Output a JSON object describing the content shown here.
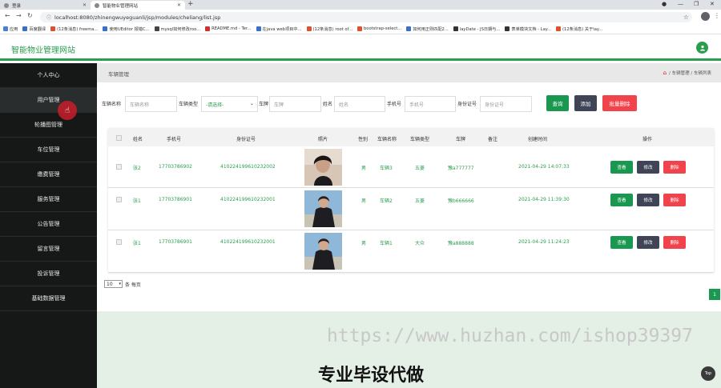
{
  "browser": {
    "tabs": [
      {
        "label": "登录"
      },
      {
        "label": "智能物业管理网站"
      }
    ],
    "url": "localhost:8080/zhinengwuyeguanli/jsp/modules/cheliang/list.jsp",
    "bookmarks": [
      "应用",
      "百度翻译",
      "(12条消息) freema...",
      "使用UEditor 报错C...",
      "mysql如何修改roo...",
      "README.md - Ter...",
      "在java web项目中...",
      "(12条消息) root of...",
      "bootstrap-select...",
      "如何用正则匹配2...",
      "layDate - JS日期与...",
      "表单模块文档 - Lay...",
      "(12条消息) 关于lay..."
    ],
    "colors": {
      "tabbar": "#dee1e6"
    }
  },
  "app": {
    "title": "智能物业管理网站",
    "brand_color": "#2a9d4e",
    "user_icon": "user-icon"
  },
  "sidebar": {
    "items": [
      {
        "label": "个人中心"
      },
      {
        "label": "用户管理"
      },
      {
        "label": "轮播图管理"
      },
      {
        "label": "车位管理"
      },
      {
        "label": "缴费管理"
      },
      {
        "label": "服务管理"
      },
      {
        "label": "公告管理"
      },
      {
        "label": "留言管理"
      },
      {
        "label": "投诉管理"
      },
      {
        "label": "基础数据管理"
      }
    ]
  },
  "breadcrumb": {
    "title": "车辆管理",
    "path": "/ 车辆管理 / 车辆列表"
  },
  "search": {
    "fields": [
      {
        "label": "车辆名称",
        "placeholder": "车辆名称"
      },
      {
        "label": "车辆类型",
        "selected": "-请选择-"
      },
      {
        "label": "车牌",
        "placeholder": "车牌"
      },
      {
        "label": "姓名",
        "placeholder": "姓名"
      },
      {
        "label": "手机号",
        "placeholder": "手机号"
      },
      {
        "label": "身份证号",
        "placeholder": "身份证号"
      }
    ],
    "buttons": {
      "query": "查询",
      "add": "添加",
      "batch_delete": "批量删除"
    }
  },
  "table": {
    "columns": [
      "姓名",
      "手机号",
      "身份证号",
      "照片",
      "性别",
      "车辆名称",
      "车辆类型",
      "车牌",
      "备注",
      "创建时间",
      "操作"
    ],
    "rows": [
      {
        "name": "张2",
        "phone": "17703786902",
        "idcard": "410224199610232002",
        "gender": "男",
        "car_name": "车辆3",
        "car_type": "五菱",
        "plate": "豫a777777",
        "remark": "",
        "created": "2021-04-29 14:07:33"
      },
      {
        "name": "张1",
        "phone": "17703786901",
        "idcard": "410224199610232001",
        "gender": "男",
        "car_name": "车辆2",
        "car_type": "五菱",
        "plate": "豫b666666",
        "remark": "",
        "created": "2021-04-29 11:39:30"
      },
      {
        "name": "张1",
        "phone": "17703786901",
        "idcard": "410224199610232001",
        "gender": "男",
        "car_name": "车辆1",
        "car_type": "大众",
        "plate": "豫a888888",
        "remark": "",
        "created": "2021-04-29 11:24:23"
      }
    ],
    "row_actions": {
      "view": "查看",
      "edit": "修改",
      "delete": "删除"
    }
  },
  "pager": {
    "per_page": "10",
    "per_page_label": "条 每页",
    "current_page": "1"
  },
  "watermark": {
    "url_text": "https://www.huzhan.com/ishop39397",
    "slogan": "专业毕设代做"
  },
  "back_to_top": "Top"
}
